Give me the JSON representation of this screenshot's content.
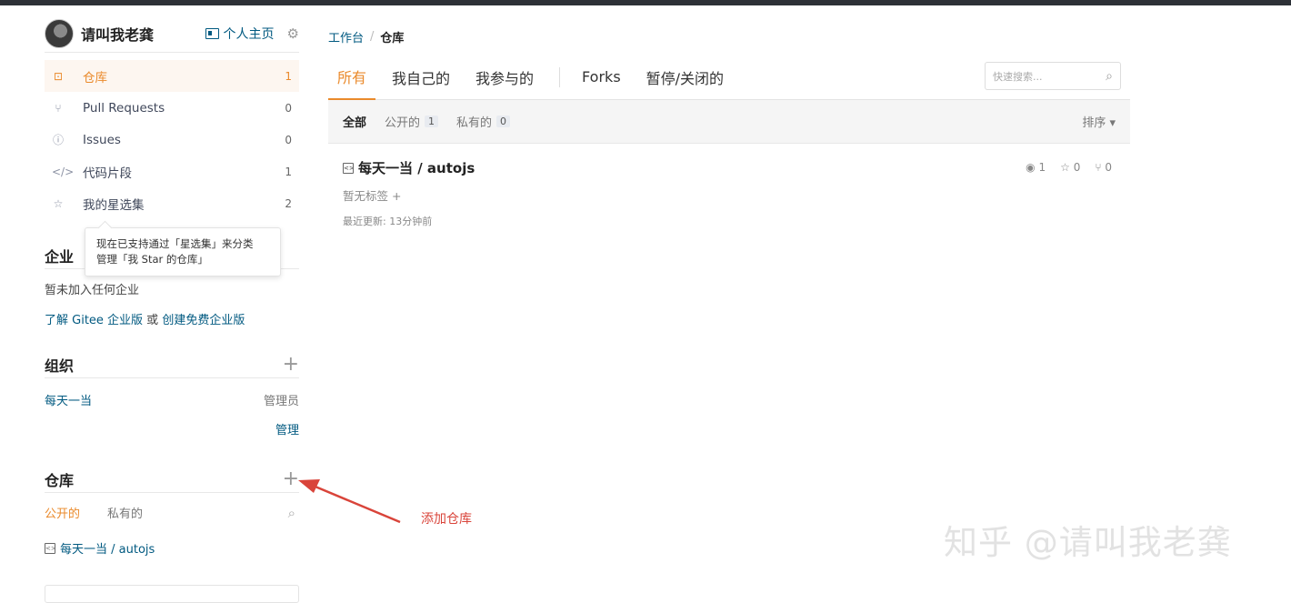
{
  "user": {
    "name": "请叫我老龚",
    "homepage_label": "个人主页"
  },
  "nav": {
    "items": [
      {
        "icon": "repo-icon",
        "glyph": "⊡",
        "label": "仓库",
        "count": "1"
      },
      {
        "icon": "pull-request-icon",
        "glyph": "⑂",
        "label": "Pull Requests",
        "count": "0"
      },
      {
        "icon": "issue-icon",
        "glyph": "ⓘ",
        "label": "Issues",
        "count": "0"
      },
      {
        "icon": "code-snippet-icon",
        "glyph": "</>",
        "label": "代码片段",
        "count": "1"
      },
      {
        "icon": "star-icon",
        "glyph": "☆",
        "label": "我的星选集",
        "count": "2"
      }
    ]
  },
  "tooltip": {
    "line1": "现在已支持通过「星选集」来分类",
    "line2": "管理「我 Star 的仓库」"
  },
  "enterprise": {
    "title": "企业",
    "empty": "暂未加入任何企业",
    "link1": "了解 Gitee 企业版",
    "or": " 或 ",
    "link2": "创建免费企业版"
  },
  "org": {
    "title": "组织",
    "name": "每天一当",
    "role": "管理员",
    "manage": "管理"
  },
  "repos_panel": {
    "title": "仓库",
    "tab_public": "公开的",
    "tab_private": "私有的",
    "item": "每天一当 / autojs"
  },
  "breadcrumb": {
    "root": "工作台",
    "sep": "/",
    "current": "仓库"
  },
  "tabs": [
    "所有",
    "我自己的",
    "我参与的",
    "Forks",
    "暂停/关闭的"
  ],
  "search": {
    "placeholder": "快速搜索..."
  },
  "filters": {
    "all": "全部",
    "public": "公开的",
    "public_count": "1",
    "private": "私有的",
    "private_count": "0",
    "sort": "排序 ▾"
  },
  "repo": {
    "title": "每天一当 / autojs",
    "watch": "1",
    "stars": "0",
    "forks": "0",
    "tags": "暂无标签",
    "updated": "最近更新: 13分钟前"
  },
  "annotation": {
    "text": "添加仓库"
  },
  "watermark": {
    "text": "知乎 @请叫我老龚"
  },
  "colors": {
    "accent": "#ea8a2b",
    "link": "#005980",
    "annotation": "#d9443a"
  }
}
